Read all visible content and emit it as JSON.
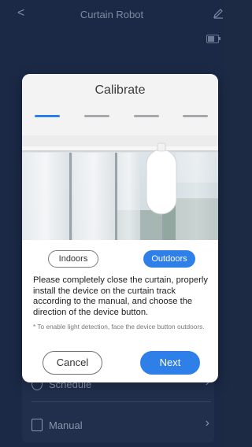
{
  "header": {
    "back_glyph": "<",
    "title": "Curtain Robot"
  },
  "background_list": [
    {
      "label": "Schedule",
      "icon": "clock-icon"
    },
    {
      "label": "Manual",
      "icon": "document-icon"
    }
  ],
  "modal": {
    "title": "Calibrate",
    "steps": {
      "total": 4,
      "current": 1
    },
    "toggle": {
      "indoors": "Indoors",
      "outdoors": "Outdoors",
      "selected": "Outdoors"
    },
    "instructions": "Please completely close the curtain, properly install the device on the curtain track according to the manual, and choose the direction of the device button.",
    "note": "* To enable light detection, face the device button outdoors.",
    "cancel_label": "Cancel",
    "next_label": "Next"
  },
  "colors": {
    "accent": "#2f7fe8",
    "overlay": "#1b2946"
  }
}
